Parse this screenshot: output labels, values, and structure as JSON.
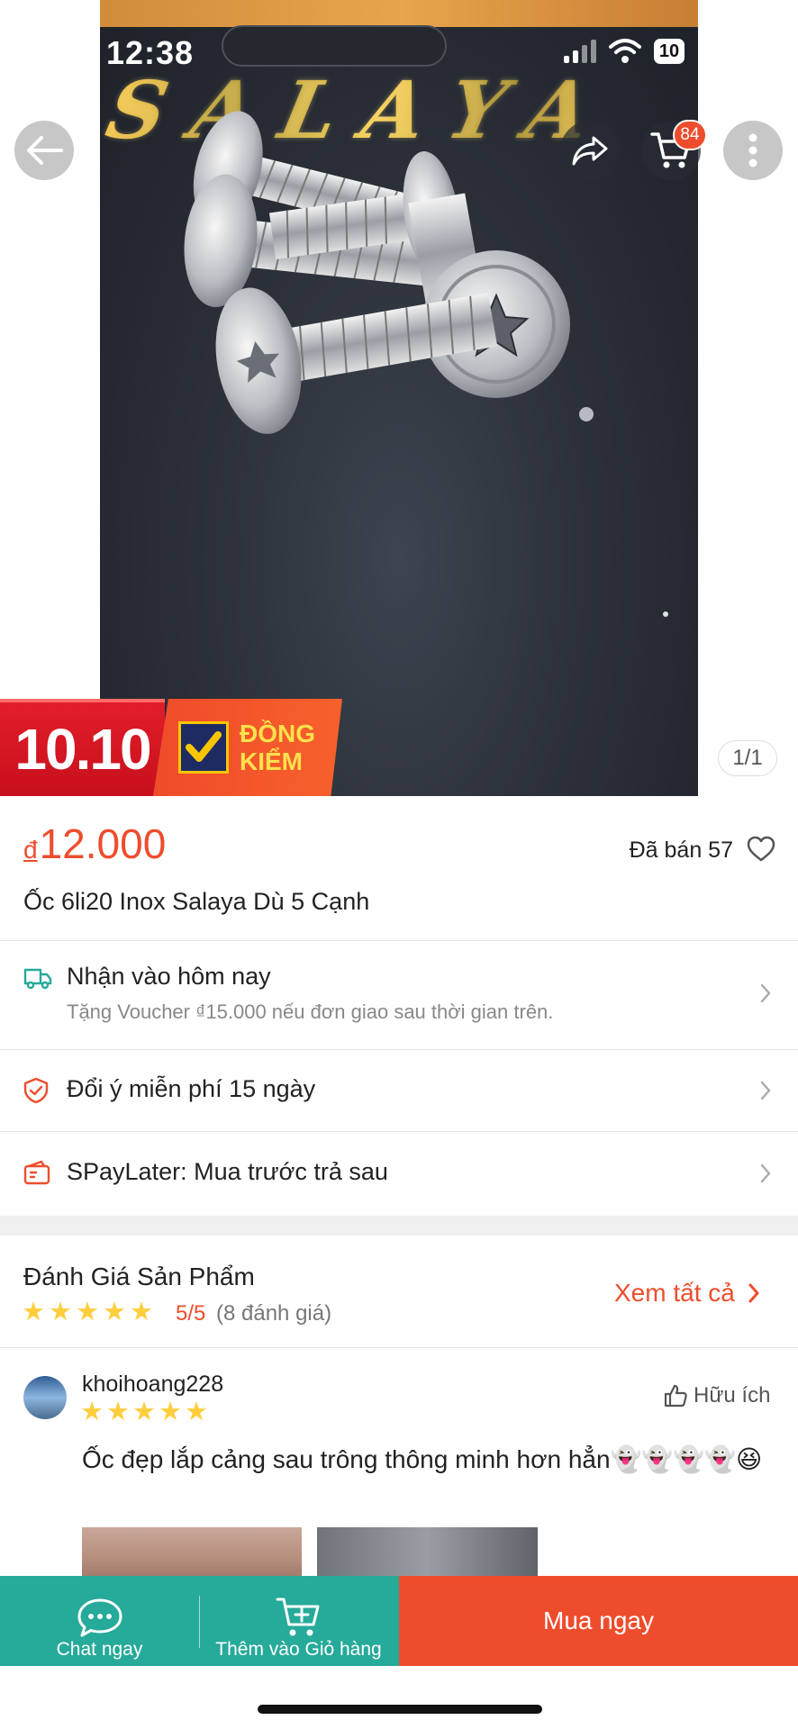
{
  "status_bar": {
    "time": "12:38",
    "battery": "10"
  },
  "header": {
    "cart_count": "84"
  },
  "product_image": {
    "brand_text": "SALAYA",
    "promo_sale": "10.10",
    "promo_badge_line1": "ĐỒNG",
    "promo_badge_line2": "KIỂM",
    "pager": "1/1"
  },
  "product": {
    "currency": "đ",
    "price": "12.000",
    "sold": "Đã bán 57",
    "title": "Ốc 6li20 Inox Salaya Dù 5 Cạnh"
  },
  "info_rows": [
    {
      "title": "Nhận vào hôm nay",
      "subtitle": "Tặng Voucher ₫15.000 nếu đơn giao sau thời gian trên.",
      "icon": "delivery-truck-icon"
    },
    {
      "title": "Đổi ý miễn phí 15 ngày",
      "icon": "shield-check-icon"
    },
    {
      "title": "SPayLater: Mua trước trả sau",
      "icon": "wallet-card-icon"
    }
  ],
  "reviews": {
    "heading": "Đánh Giá Sản Phẩm",
    "score": "5/5",
    "count": "(8 đánh giá)",
    "see_all": "Xem tất cả",
    "items": [
      {
        "username": "khoihoang228",
        "rating": 5,
        "helpful": "Hữu ích",
        "comment": "Ốc đẹp lắp cảng sau trông thông minh hơn hẳn👻👻👻👻😆"
      }
    ]
  },
  "bottom_bar": {
    "chat": "Chat ngay",
    "add_to_cart": "Thêm vào Giỏ hàng",
    "buy_now": "Mua ngay"
  },
  "colors": {
    "accent": "#ee4d2d",
    "teal": "#26aa99",
    "star": "#ffce3d"
  }
}
